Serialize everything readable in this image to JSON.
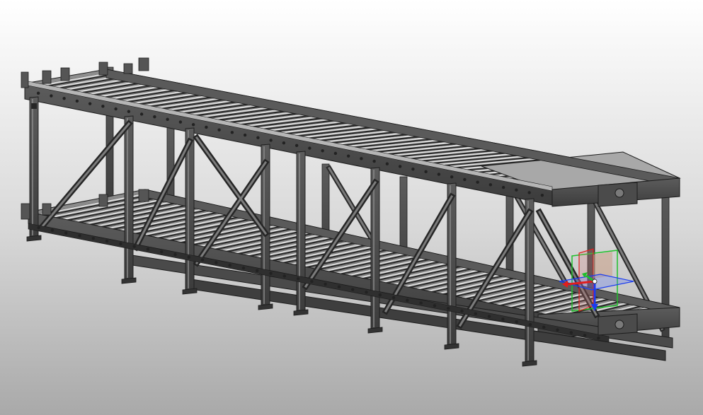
{
  "viewport": {
    "background_top": "#ffffff",
    "background_bottom": "#a9a9a9"
  },
  "model": {
    "steel_color": "#6a6a6a",
    "steel_dark": "#3a3a3a",
    "steel_light": "#9c9c9c",
    "roller_color": "#bdbdbd",
    "outline_color": "#1c1c1c"
  },
  "triad": {
    "x_color": "#e01e1e",
    "y_color": "#1fbf2a",
    "z_color": "#1a3cf0",
    "plane_red": "#d97a7a",
    "plane_green": "#3fd24c",
    "plane_blue": "#4a6cff"
  }
}
